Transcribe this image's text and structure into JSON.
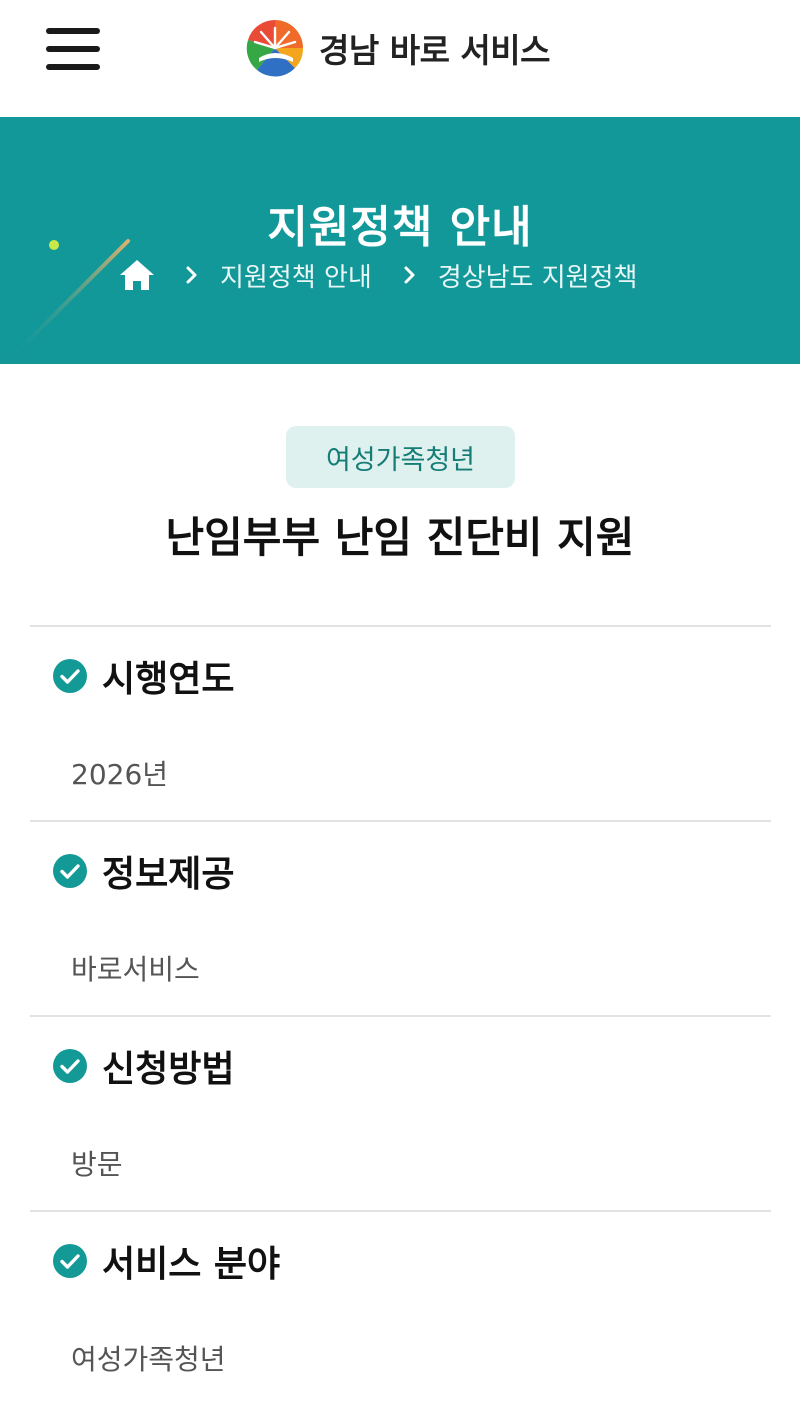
{
  "header": {
    "menu_icon": "hamburger-menu-icon",
    "logo_icon": "gyeongnam-logo-icon",
    "brand_name": "경남 바로 서비스"
  },
  "hero": {
    "title": "지원정책 안내",
    "breadcrumb": {
      "home_icon": "home-icon",
      "separator_icon": "chevron-right-icon",
      "items": [
        "지원정책 안내",
        "경상남도 지원정책"
      ]
    },
    "background_color": "#13989a"
  },
  "policy": {
    "category": "여성가족청년",
    "title": "난임부부 난임 진단비 지원"
  },
  "sections": [
    {
      "label": "시행연도",
      "value": "2026년"
    },
    {
      "label": "정보제공",
      "value": "바로서비스"
    },
    {
      "label": "신청방법",
      "value": "방문"
    },
    {
      "label": "서비스 분야",
      "value": "여성가족청년"
    }
  ],
  "colors": {
    "accent": "#13989a",
    "badge_bg": "#dff1ef",
    "badge_text": "#157c76",
    "check": "#149a96"
  }
}
